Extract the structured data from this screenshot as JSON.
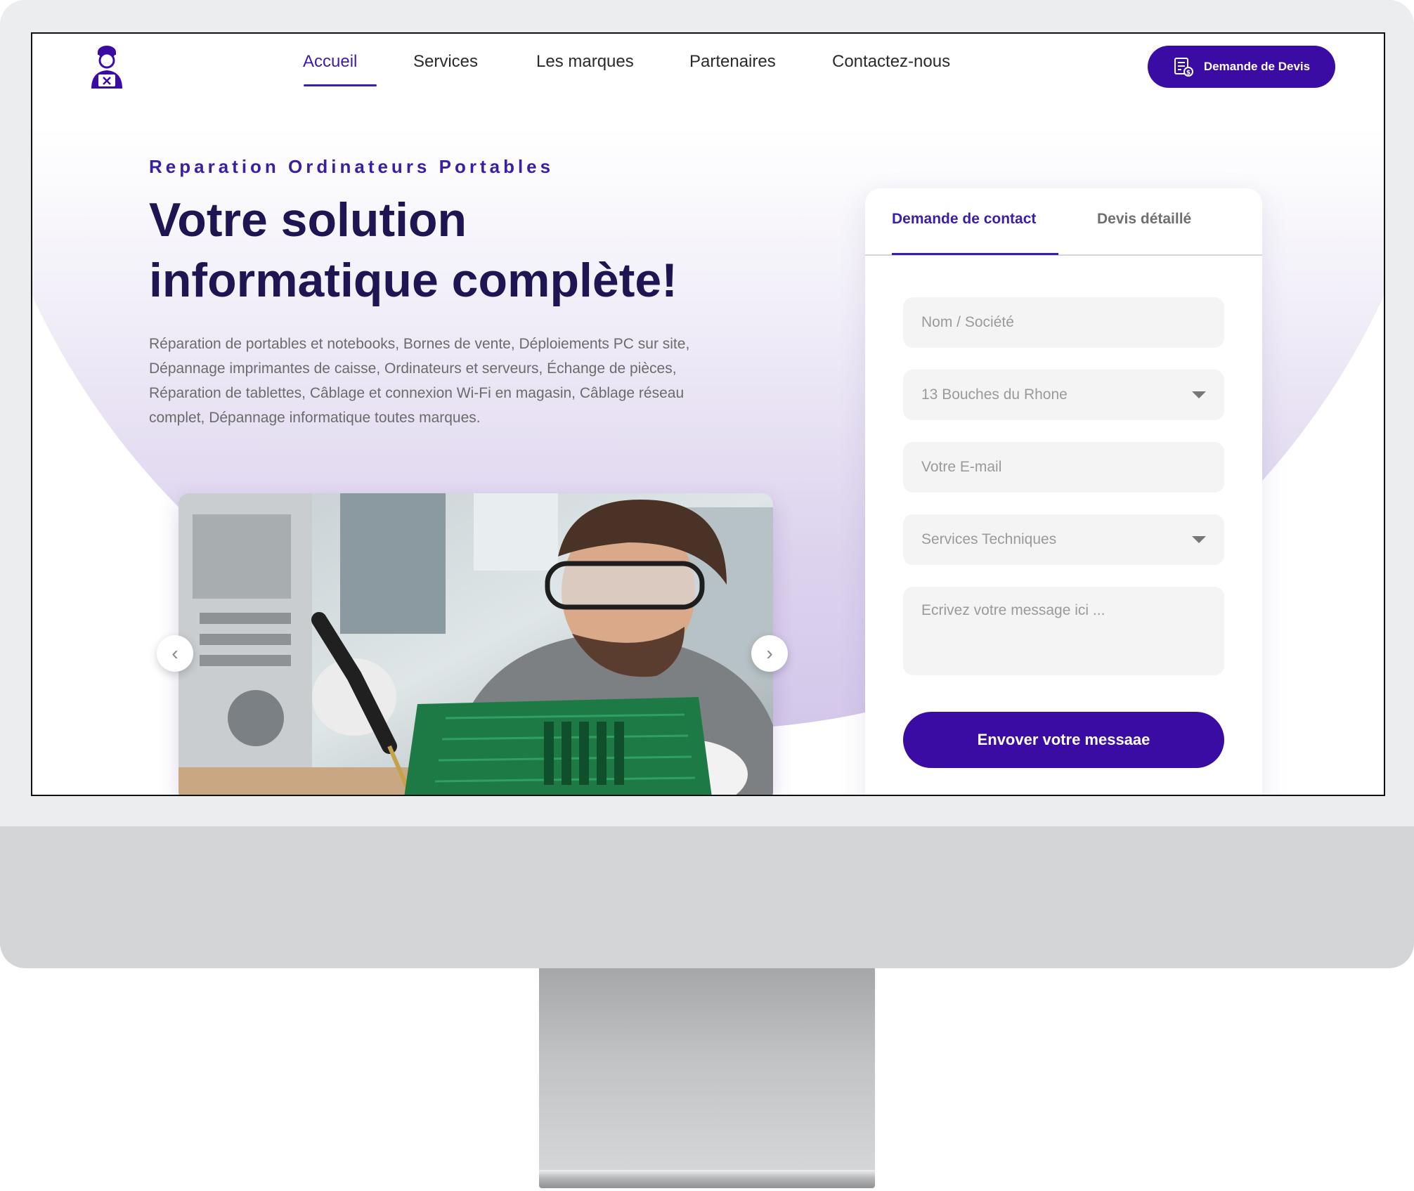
{
  "nav": {
    "items": [
      {
        "label": "Accueil",
        "active": true
      },
      {
        "label": "Services",
        "active": false
      },
      {
        "label": "Les marques",
        "active": false
      },
      {
        "label": "Partenaires",
        "active": false
      },
      {
        "label": "Contactez-nous",
        "active": false
      }
    ],
    "quote_button": "Demande de Devis"
  },
  "hero": {
    "eyebrow": "Reparation Ordinateurs Portables",
    "title_line1": "Votre solution",
    "title_line2": "informatique complète!",
    "description": "Réparation de portables et notebooks, Bornes de vente, Déploiements PC sur site, Dépannage imprimantes de caisse, Ordinateurs et serveurs, Échange de pièces, Réparation de tablettes, Câblage et connexion Wi-Fi en magasin, Câblage réseau complet, Dépannage informatique toutes marques.",
    "carousel": {
      "prev_icon": "chevron-left-icon",
      "next_icon": "chevron-right-icon"
    }
  },
  "form": {
    "tabs": [
      {
        "label": "Demande de contact",
        "active": true
      },
      {
        "label": "Devis détaillé",
        "active": false
      }
    ],
    "name_placeholder": "Nom / Société",
    "region_value": "13 Bouches du Rhone",
    "email_placeholder": "Votre E-mail",
    "service_value": "Services Techniques",
    "message_placeholder": "Ecrivez votre message ici ...",
    "submit_label": "Envover votre messaae"
  },
  "colors": {
    "brand": "#3a0ca3",
    "accent_text": "#3a1fa6",
    "heading": "#1f1552"
  }
}
